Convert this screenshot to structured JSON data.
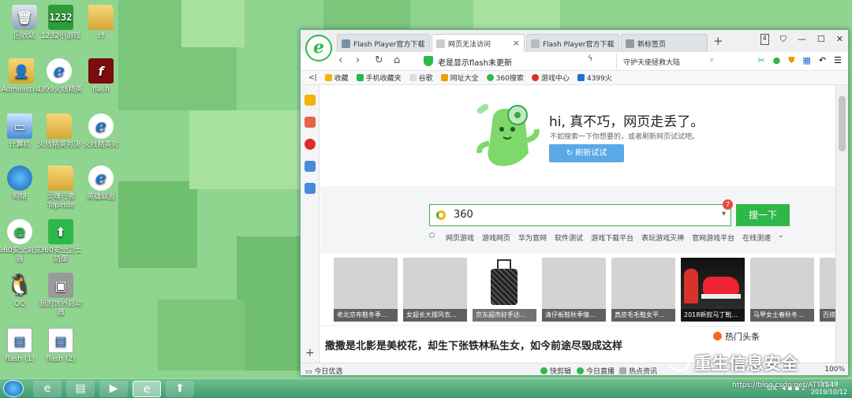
{
  "desktop": {
    "icons": [
      {
        "label": "回收站",
        "icon": "recycle-bin-icon"
      },
      {
        "label": "1232小游戏",
        "icon": "game-icon"
      },
      {
        "label": "cf",
        "icon": "folder-icon"
      },
      {
        "label": "Administr...",
        "icon": "user-folder-icon"
      },
      {
        "label": "4399火线精英",
        "icon": "ie-icon"
      },
      {
        "label": "flash",
        "icon": "flash-icon"
      },
      {
        "label": "计算机",
        "icon": "computer-icon"
      },
      {
        "label": "火线精英对决",
        "icon": "folder-icon"
      },
      {
        "label": "火线精英对",
        "icon": "ie-icon"
      },
      {
        "label": "网络",
        "icon": "network-icon"
      },
      {
        "label": "灵魂行者 Topindo",
        "icon": "folder-icon"
      },
      {
        "label": "英雄联盟",
        "icon": "ie-icon"
      },
      {
        "label": "360安全浏览器",
        "icon": "browser-360-icon"
      },
      {
        "label": "360安全卫士防御",
        "icon": "shield-360-icon"
      },
      {
        "label": "QQ",
        "icon": "qq-icon"
      },
      {
        "label": "我的世界启动器",
        "icon": "minecraft-icon"
      },
      {
        "label": "flash (1)",
        "icon": "document-icon"
      },
      {
        "label": "flash (2)",
        "icon": "document-icon"
      }
    ]
  },
  "browser": {
    "tabs": [
      {
        "label": "Flash Player官方下载",
        "active": false
      },
      {
        "label": "网页无法访问",
        "active": true
      },
      {
        "label": "Flash Player官方下载",
        "active": false
      },
      {
        "label": "新标签页",
        "active": false
      }
    ],
    "tab_count": "4",
    "address": "老是显示flash未更新",
    "search_box": "守护天使拯救大陆",
    "bookmarks": {
      "toggle": "<|",
      "items": [
        "收藏",
        "手机收藏夹",
        "谷歌",
        "网址大全",
        "360搜索",
        "游戏中心",
        "4399火"
      ]
    },
    "error": {
      "title": "hi, 真不巧，网页走丢了。",
      "subtitle": "不如搜索一下你想要的，或者刷新网页试试吧。",
      "retry_label": "刷新试试"
    },
    "search": {
      "value": "360",
      "badge": "7",
      "button_label": "搜一下",
      "hot_links": [
        "网页游戏",
        "游戏网页",
        "华为官网",
        "软件测试",
        "游戏下载平台",
        "表玩游戏灭神",
        "官网游戏平台",
        "在线测速"
      ]
    },
    "thumbnails": [
      "老北京布鞋冬季...",
      "女超长大摆风衣...",
      "京东超市好手达...",
      "清仔板鞋秋季情...",
      "真皮毛毛鞋女平...",
      "2018新款马丁靴...",
      "马甲女士春秋冬...",
      "百搭"
    ],
    "news_headline": "撒撒是北影是美校花，却生下张铁林私生女，如今前途尽毁成这样",
    "hot_news_label": "热门头条",
    "statusbar": {
      "left": "今日优选",
      "items": [
        "快剪辑",
        "今日直播",
        "热点资讯"
      ],
      "zoom": "100%"
    }
  },
  "taskbar": {
    "time": "23:19",
    "date": "2019/10/12",
    "tray_text": "CX"
  },
  "watermark": {
    "text": "重生信息安全",
    "url": "https://blog.csdn.net/ATTYS4"
  }
}
